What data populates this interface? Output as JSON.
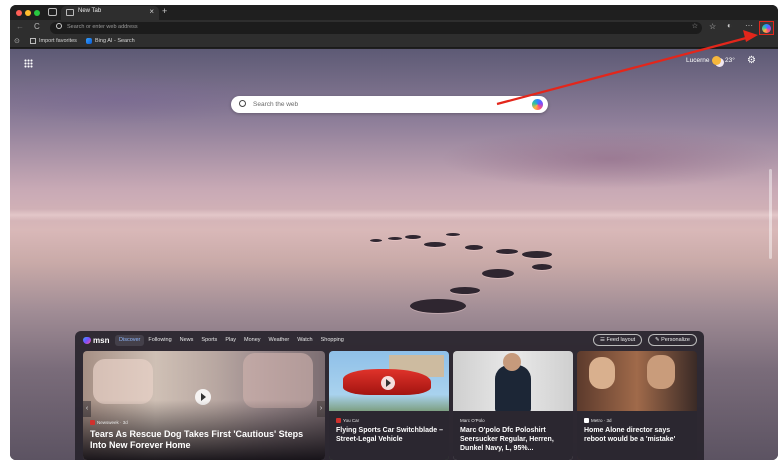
{
  "browser": {
    "tab_title": "New Tab",
    "tab_close": "×",
    "new_tab": "+",
    "address_placeholder": "Search or enter web address",
    "more_label": "···",
    "nav_back": "←",
    "nav_reload": "C"
  },
  "favorites": {
    "items": [
      {
        "label": "Import favorites",
        "icon": "import-icon"
      },
      {
        "label": "Bing AI - Search",
        "icon": "bing-icon"
      }
    ]
  },
  "page": {
    "weather_location": "Lucerne",
    "weather_temp": "23°",
    "search_placeholder": "Search the web"
  },
  "feed": {
    "logo": "msn",
    "tabs": [
      "Discover",
      "Following",
      "News",
      "Sports",
      "Play",
      "Money",
      "Weather",
      "Watch",
      "Shopping"
    ],
    "active_tab": "Discover",
    "layout_label": "Feed layout",
    "personalize_label": "Personalize",
    "cards": [
      {
        "source": "Newsweek · 3d",
        "headline": "Tears As Rescue Dog Takes First 'Cautious' Steps Into New Forever Home",
        "source_color": "#d0312d"
      },
      {
        "source": "You Car",
        "headline": "Flying Sports Car Switchblade – Street-Legal Vehicle",
        "source_color": "#d0312d"
      },
      {
        "source": "Marc O'Polo",
        "headline": "Marc O'polo Dfc Poloshirt Seersucker Regular, Herren, Dunkel Navy, L, 95%...",
        "source_color": ""
      },
      {
        "source": "Metro · 3d",
        "headline": "Home Alone director says reboot would be a 'mistake'",
        "source_color": "#ffffff"
      }
    ]
  },
  "colors": {
    "annotation": "#e3261b",
    "active_tab_text": "#8fb8ff"
  }
}
